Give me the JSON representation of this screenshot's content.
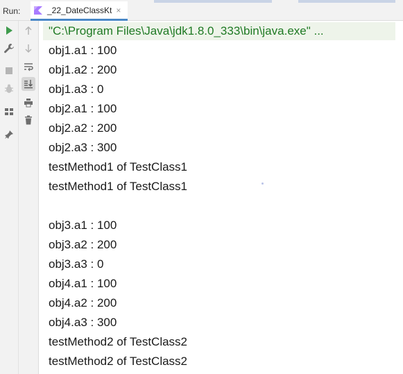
{
  "run_panel": {
    "label": "Run:",
    "tab_label": "_22_DateClassKt",
    "tab_close": "×"
  },
  "toolbar": {
    "left": [
      {
        "icon": "play-icon"
      },
      {
        "icon": "wrench-icon"
      },
      {
        "icon": "stop-icon"
      },
      {
        "icon": "debug-bug-icon"
      },
      {
        "icon": "layout-icon"
      },
      {
        "icon": "pin-icon"
      }
    ],
    "right": [
      {
        "icon": "arrow-up-icon"
      },
      {
        "icon": "arrow-down-icon"
      },
      {
        "icon": "soft-wrap-icon"
      },
      {
        "icon": "scroll-to-end-icon"
      },
      {
        "icon": "print-icon"
      },
      {
        "icon": "trash-icon"
      }
    ]
  },
  "console": {
    "command": "\"C:\\Program Files\\Java\\jdk1.8.0_333\\bin\\java.exe\" ...",
    "lines": [
      "obj1.a1 : 100",
      "obj1.a2 : 200",
      "obj1.a3 : 0",
      "obj2.a1 : 100",
      "obj2.a2 : 200",
      "obj2.a3 : 300",
      "testMethod1 of TestClass1",
      "testMethod1 of TestClass1",
      "",
      "obj3.a1 : 100",
      "obj3.a2 : 200",
      "obj3.a3 : 0",
      "obj4.a1 : 100",
      "obj4.a2 : 200",
      "obj4.a3 : 300",
      "testMethod2 of TestClass2",
      "testMethod2 of TestClass2"
    ]
  },
  "colors": {
    "command_text": "#1f7a24",
    "output_text": "#1a1a1a",
    "accent": "#4a88c7",
    "run_green": "#3f9b4d"
  }
}
